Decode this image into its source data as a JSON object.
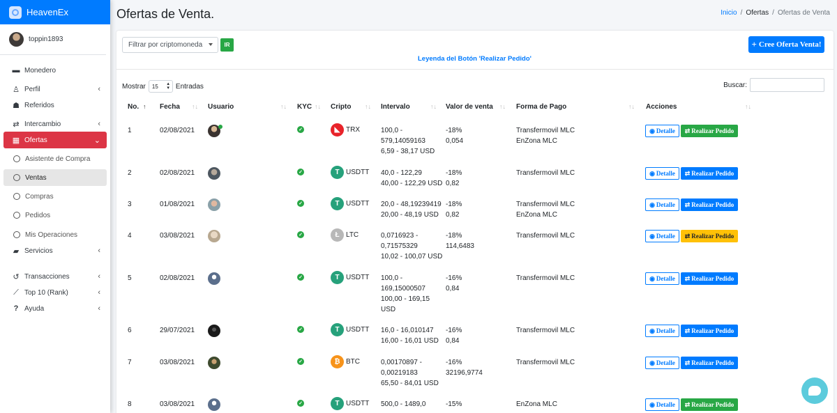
{
  "app": {
    "brand": "HeavenEx",
    "user": "toppin1893"
  },
  "sidebar": {
    "items": [
      {
        "label": "Monedero",
        "icon": "wallet-icon",
        "type": "main",
        "chevron": false
      },
      {
        "label": "Perfil",
        "icon": "user-icon",
        "type": "main",
        "chevron": true
      },
      {
        "label": "Referidos",
        "icon": "users-icon",
        "type": "main",
        "chevron": false
      },
      {
        "label": "Intercambio",
        "icon": "exchange-icon",
        "type": "main",
        "chevron": true
      },
      {
        "label": "Ofertas",
        "icon": "store-icon",
        "type": "active",
        "chevron": true
      },
      {
        "label": "Asistente de Compra",
        "type": "sub"
      },
      {
        "label": "Ventas",
        "type": "current"
      },
      {
        "label": "Compras",
        "type": "sub"
      },
      {
        "label": "Pedidos",
        "type": "sub"
      },
      {
        "label": "Mis Operaciones",
        "type": "sub"
      },
      {
        "label": "Servicios",
        "icon": "briefcase-icon",
        "type": "main",
        "chevron": true
      },
      {
        "label": "Transacciones",
        "icon": "history-icon",
        "type": "main",
        "chevron": true
      },
      {
        "label": "Top 10 (Rank)",
        "icon": "chart-icon",
        "type": "main",
        "chevron": true
      },
      {
        "label": "Ayuda",
        "icon": "question-icon",
        "type": "main",
        "chevron": true
      }
    ]
  },
  "header": {
    "title": "Ofertas de Venta.",
    "breadcrumb": [
      "Inicio",
      "Ofertas",
      "Ofertas de Venta"
    ]
  },
  "toolbar": {
    "filter_placeholder": "Filtrar por criptomoneda",
    "ir_label": "IR",
    "legend_link": "Leyenda del Botón 'Realizar Pedido'",
    "create_label": "Cree Oferta Venta!"
  },
  "table_controls": {
    "show_label": "Mostrar",
    "entries_value": "15",
    "entries_label": "Entradas",
    "search_label": "Buscar:"
  },
  "table": {
    "columns": [
      "No.",
      "Fecha",
      "Usuario",
      "KYC",
      "Cripto",
      "Intervalo",
      "Valor de venta",
      "Forma de Pago",
      "Acciones"
    ],
    "detail_label": "Detalle",
    "order_label": "Realizar Pedido",
    "rows": [
      {
        "no": "1",
        "fecha": "02/08/2021",
        "crypto": "TRX",
        "intervalo": [
          "100,0 -",
          "579,14059163",
          "6,59 - 38,17 USD"
        ],
        "valor": [
          "-18%",
          "0,054"
        ],
        "pago": [
          "Transfermovil MLC",
          "EnZona MLC"
        ],
        "btn_color": "green"
      },
      {
        "no": "2",
        "fecha": "02/08/2021",
        "crypto": "USDTT",
        "intervalo": [
          "40,0 - 122,29",
          "40,00 - 122,29 USD"
        ],
        "valor": [
          "-18%",
          "0,82"
        ],
        "pago": [
          "Transfermovil MLC"
        ],
        "btn_color": "blue"
      },
      {
        "no": "3",
        "fecha": "01/08/2021",
        "crypto": "USDTT",
        "intervalo": [
          "20,0 - 48,19239419",
          "20,00 - 48,19 USD"
        ],
        "valor": [
          "-18%",
          "0,82"
        ],
        "pago": [
          "Transfermovil MLC",
          "EnZona MLC"
        ],
        "btn_color": "blue"
      },
      {
        "no": "4",
        "fecha": "03/08/2021",
        "crypto": "LTC",
        "intervalo": [
          "0,0716923 -",
          "0,71575329",
          "10,02 - 100,07 USD"
        ],
        "valor": [
          "-18%",
          "114,6483"
        ],
        "pago": [
          "Transfermovil MLC"
        ],
        "btn_color": "yellow"
      },
      {
        "no": "5",
        "fecha": "02/08/2021",
        "crypto": "USDTT",
        "intervalo": [
          "100,0 -",
          "169,15000507",
          "100,00 - 169,15",
          "USD"
        ],
        "valor": [
          "-16%",
          "0,84"
        ],
        "pago": [
          "Transfermovil MLC"
        ],
        "btn_color": "blue"
      },
      {
        "no": "6",
        "fecha": "29/07/2021",
        "crypto": "USDTT",
        "intervalo": [
          "16,0 - 16,010147",
          "16,00 - 16,01 USD"
        ],
        "valor": [
          "-16%",
          "0,84"
        ],
        "pago": [
          "Transfermovil MLC"
        ],
        "btn_color": "blue"
      },
      {
        "no": "7",
        "fecha": "03/08/2021",
        "crypto": "BTC",
        "intervalo": [
          "0,00170897 -",
          "0,00219183",
          "65,50 - 84,01 USD"
        ],
        "valor": [
          "-16%",
          "32196,9774"
        ],
        "pago": [
          "Transfermovil MLC"
        ],
        "btn_color": "blue"
      },
      {
        "no": "8",
        "fecha": "03/08/2021",
        "crypto": "USDTT",
        "intervalo": [
          "500,0 - 1489,0"
        ],
        "valor": [
          "-15%"
        ],
        "pago": [
          "EnZona MLC"
        ],
        "btn_color": "green"
      }
    ]
  },
  "colors": {
    "primary": "#007bff",
    "danger": "#dc3545",
    "success": "#28a745",
    "warning": "#ffc107",
    "trx": "#e8232a",
    "usdt": "#26a17b",
    "ltc": "#b8b8b8",
    "btc": "#f7931a"
  }
}
